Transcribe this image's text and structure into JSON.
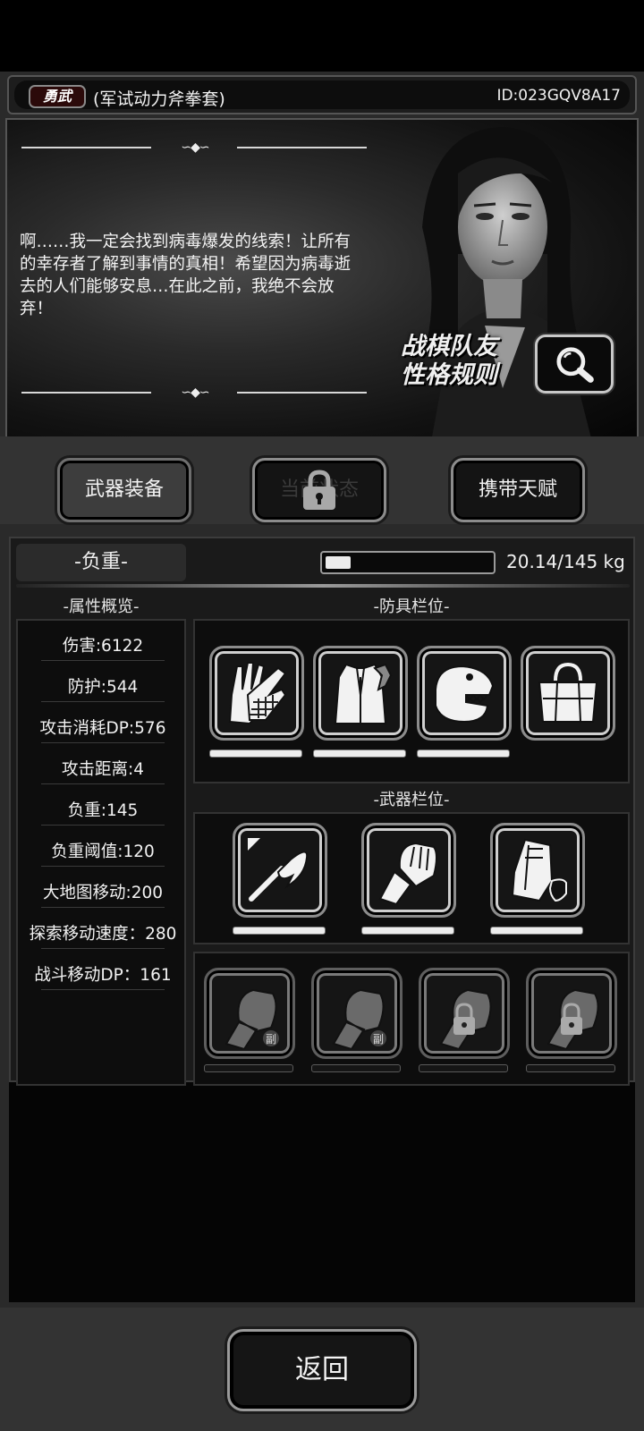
{
  "header": {
    "badge": "勇武",
    "weapon_name": "(军试动力斧拳套)",
    "player_id": "ID:023GQV8A17"
  },
  "story": {
    "quote": "啊……我一定会找到病毒爆发的线索！让所有的幸存者了解到事情的真相！希望因为病毒逝去的人们能够安息…在此之前，我绝不会放弃！",
    "rules_line1": "战棋队友",
    "rules_line2": "性格规则",
    "search_icon": "magnifier-icon"
  },
  "tabs": [
    {
      "label": "武器装备",
      "state": "active"
    },
    {
      "label": "当前状态",
      "state": "locked"
    },
    {
      "label": "携带天赋",
      "state": "normal"
    }
  ],
  "weight": {
    "title": "-负重-",
    "current": 20.14,
    "max": 145,
    "text": "20.14/145 kg"
  },
  "attributes": {
    "heading": "-属性概览-",
    "items": [
      "伤害:6122",
      "防护:544",
      "攻击消耗DP:576",
      "攻击距离:4",
      "负重:145",
      "负重阈值:120",
      "大地图移动:200",
      "探索移动速度：280",
      "战斗移动DP：161"
    ]
  },
  "armor": {
    "heading": "-防具栏位-",
    "slots": [
      {
        "icon": "chainmail-gloves-icon",
        "durability": 1.0
      },
      {
        "icon": "fur-jacket-icon",
        "durability": 1.0
      },
      {
        "icon": "dinosaur-head-icon",
        "durability": 1.0
      },
      {
        "icon": "duffel-bag-icon",
        "durability": null
      }
    ]
  },
  "weapons": {
    "heading": "-武器栏位-",
    "slots": [
      {
        "icon": "curved-blade-icon",
        "durability": 1.0
      },
      {
        "icon": "power-fist-icon",
        "durability": 1.0
      },
      {
        "icon": "armor-plate-icon",
        "durability": 1.0
      }
    ],
    "secondary_slots": [
      {
        "icon": "fist-icon",
        "tag": "副",
        "locked": false
      },
      {
        "icon": "fist-icon",
        "tag": "副",
        "locked": false
      },
      {
        "icon": "fist-icon",
        "tag": "",
        "locked": true
      },
      {
        "icon": "fist-icon",
        "tag": "",
        "locked": true
      }
    ]
  },
  "footer": {
    "back_label": "返回"
  }
}
